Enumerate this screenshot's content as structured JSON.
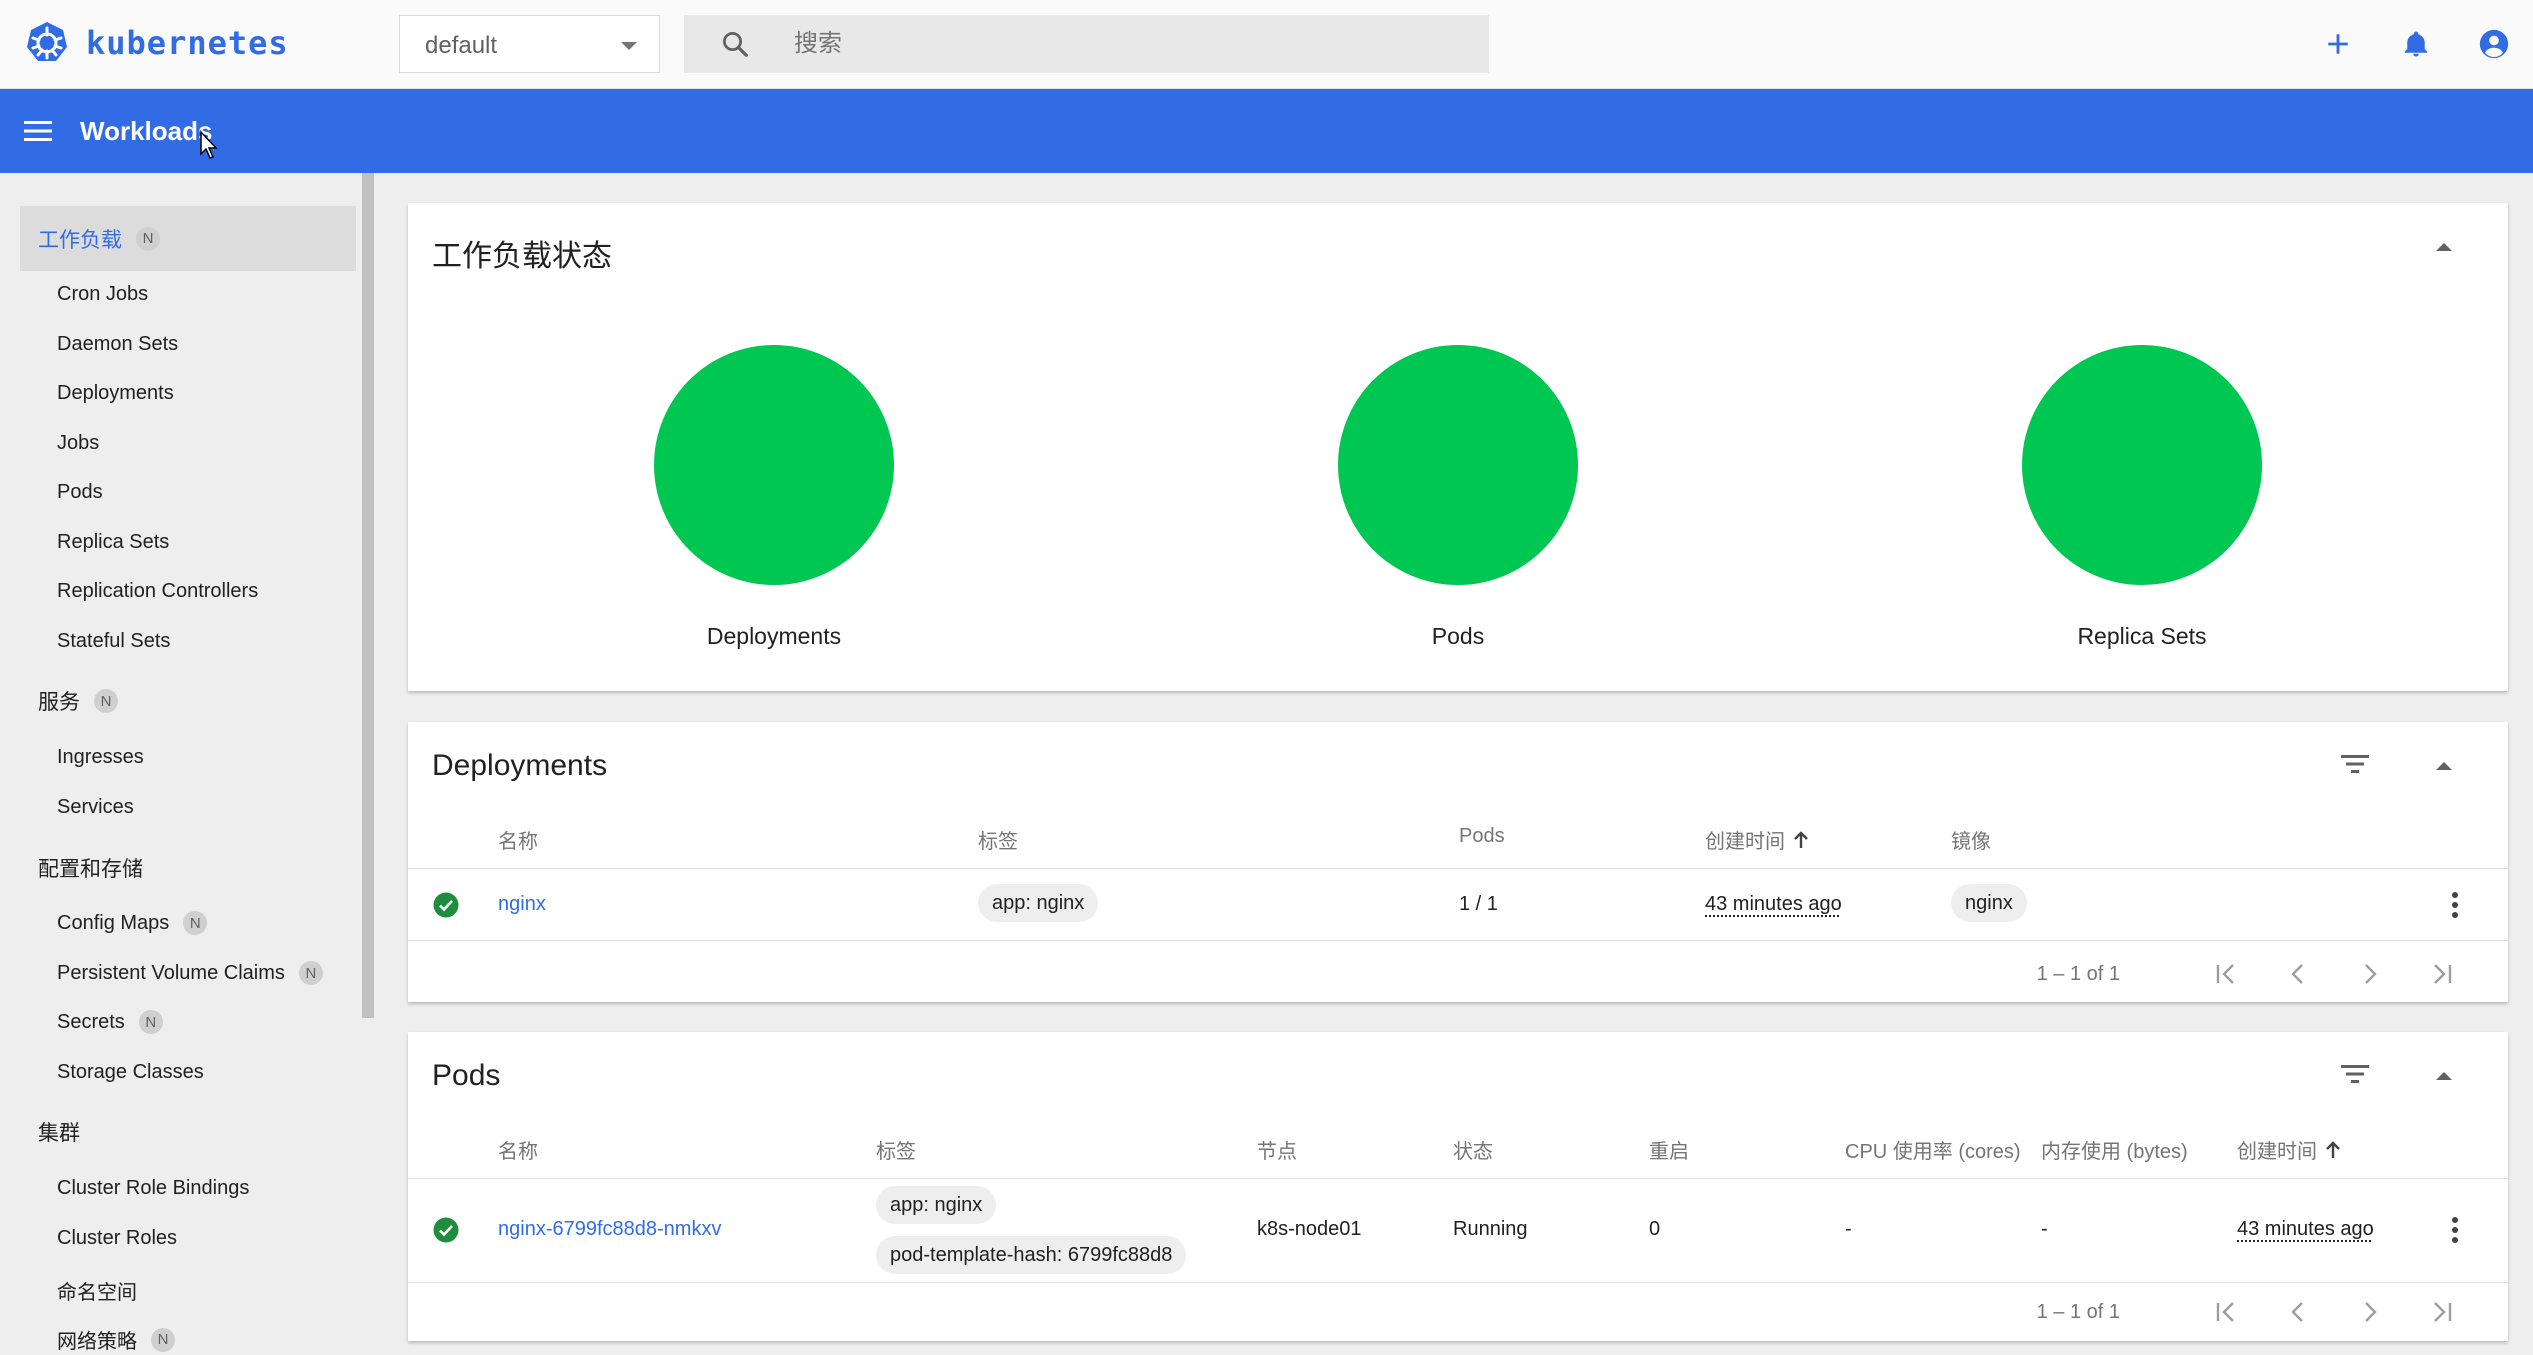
{
  "header": {
    "brand": "kubernetes",
    "namespace": "default",
    "search_placeholder": "搜索",
    "section_title": "Workloads"
  },
  "colors": {
    "accent": "#326ce5",
    "status_ok": "#00c752",
    "check": "#1e8e3e"
  },
  "icons": [
    "kubernetes-logo-icon",
    "search-icon",
    "add-icon",
    "bell-icon",
    "account-icon",
    "menu-icon",
    "filter-icon",
    "check-circle-icon",
    "more-vert-icon",
    "first-page-icon",
    "prev-page-icon",
    "next-page-icon",
    "last-page-icon"
  ],
  "sidebar": {
    "workloads": {
      "label": "工作负载",
      "badge": "N"
    },
    "workload_items": [
      "Cron Jobs",
      "Daemon Sets",
      "Deployments",
      "Jobs",
      "Pods",
      "Replica Sets",
      "Replication Controllers",
      "Stateful Sets"
    ],
    "service": {
      "label": "服务",
      "badge": "N"
    },
    "service_items": [
      "Ingresses",
      "Services"
    ],
    "config": {
      "label": "配置和存储"
    },
    "config_items": [
      {
        "label": "Config Maps",
        "badge": "N"
      },
      {
        "label": "Persistent Volume Claims",
        "badge": "N"
      },
      {
        "label": "Secrets",
        "badge": "N"
      },
      {
        "label": "Storage Classes",
        "badge": ""
      }
    ],
    "cluster": {
      "label": "集群"
    },
    "cluster_items": [
      {
        "label": "Cluster Role Bindings",
        "badge": ""
      },
      {
        "label": "Cluster Roles",
        "badge": ""
      },
      {
        "label": "命名空间",
        "badge": ""
      },
      {
        "label": "网络策略",
        "badge": "N"
      }
    ]
  },
  "status_card": {
    "title": "工作负载状态",
    "items": [
      {
        "label": "Deployments",
        "ok_fraction": 1.0
      },
      {
        "label": "Pods",
        "ok_fraction": 1.0
      },
      {
        "label": "Replica Sets",
        "ok_fraction": 1.0
      }
    ]
  },
  "deployments": {
    "title": "Deployments",
    "columns": [
      "名称",
      "标签",
      "Pods",
      "创建时间",
      "镜像"
    ],
    "rows": [
      {
        "name": "nginx",
        "labels": [
          "app: nginx"
        ],
        "pods": "1 / 1",
        "created": "43 minutes ago",
        "image": "nginx"
      }
    ],
    "range": "1 – 1 of 1"
  },
  "pods": {
    "title": "Pods",
    "columns": [
      "名称",
      "标签",
      "节点",
      "状态",
      "重启",
      "CPU 使用率 (cores)",
      "内存使用 (bytes)",
      "创建时间"
    ],
    "rows": [
      {
        "name": "nginx-6799fc88d8-nmkxv",
        "labels": [
          "app: nginx",
          "pod-template-hash: 6799fc88d8"
        ],
        "node": "k8s-node01",
        "status": "Running",
        "restarts": "0",
        "cpu": "-",
        "memory": "-",
        "created": "43 minutes ago"
      }
    ],
    "range": "1 – 1 of 1"
  }
}
